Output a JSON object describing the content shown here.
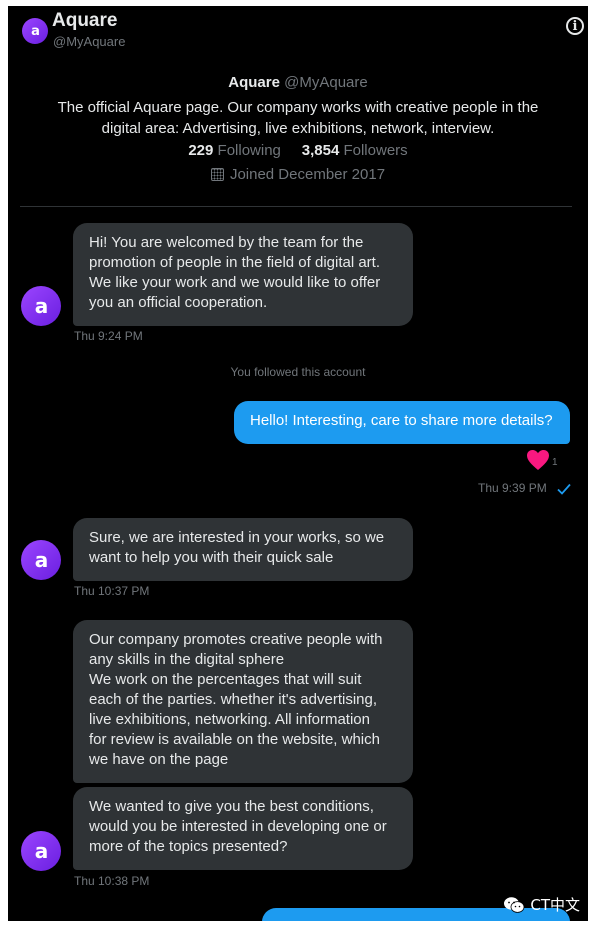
{
  "header": {
    "name": "Aquare",
    "handle": "@MyAquare",
    "info_icon": "info-icon"
  },
  "profile": {
    "name": "Aquare",
    "handle": "@MyAquare",
    "bio_line1": "The official Aquare page. Our company works with creative people in the",
    "bio_line2": "digital area: Advertising, live exhibitions, network, interview.",
    "following_count": "229",
    "following_label": "Following",
    "followers_count": "3,854",
    "followers_label": "Followers",
    "joined": "Joined December 2017"
  },
  "messages": [
    {
      "direction": "in",
      "text": "Hi! You are welcomed by the team for the\npromotion of people in the field of digital art.\nWe like your work and we would like to offer\nyou an official cooperation.",
      "time": "Thu 9:24 PM"
    },
    {
      "direction": "system",
      "text": "You followed this account"
    },
    {
      "direction": "out",
      "text": "Hello! Interesting, care to share more details?",
      "reaction_count": "1",
      "time": "Thu 9:39 PM"
    },
    {
      "direction": "in",
      "text": "Sure, we are interested in your works, so we\nwant to help you with their quick sale",
      "time": "Thu 10:37 PM"
    },
    {
      "direction": "in",
      "text": "Our company promotes creative people with\nany skills in the digital sphere\nWe work on the percentages that will suit\neach of the parties. whether it's advertising,\nlive exhibitions, networking. All information\nfor review is available on the website, which\nwe have on the page"
    },
    {
      "direction": "in",
      "text": "We wanted to give you the best conditions,\nwould you be interested in developing one or\nmore of the topics presented?",
      "time": "Thu 10:38 PM"
    }
  ],
  "watermark": {
    "text": "CT中文"
  },
  "colors": {
    "background": "#000000",
    "incoming_bubble": "#2f3336",
    "outgoing_bubble": "#1d9bf0",
    "avatar": "#8a3ffc",
    "heart": "#f91880",
    "muted_text": "#71767b"
  }
}
